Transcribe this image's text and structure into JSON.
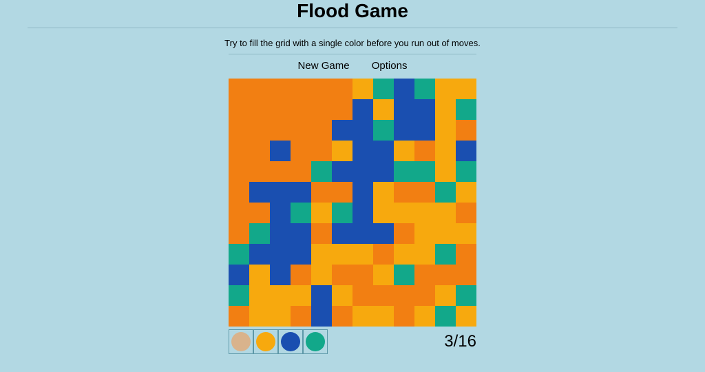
{
  "header": {
    "title": "Flood Game",
    "instructions": "Try to fill the grid with a single color before you run out of moves."
  },
  "menu": {
    "new_game": "New Game",
    "options": "Options"
  },
  "palette": {
    "colors": {
      "0": "#f27f12",
      "1": "#f7a90e",
      "2": "#1a4fb0",
      "3": "#12a88a",
      "4": "#d9b38c"
    }
  },
  "swatches": [
    {
      "name": "tan",
      "color": "#d9b38c"
    },
    {
      "name": "gold",
      "color": "#f7a90e"
    },
    {
      "name": "blue",
      "color": "#1a4fb0"
    },
    {
      "name": "teal",
      "color": "#12a88a"
    }
  ],
  "moves": {
    "current": 3,
    "total": 16,
    "display": "3/16"
  },
  "grid": [
    [
      0,
      0,
      0,
      0,
      0,
      0,
      1,
      3,
      2,
      3,
      1,
      1
    ],
    [
      0,
      0,
      0,
      0,
      0,
      0,
      2,
      1,
      2,
      2,
      1,
      3
    ],
    [
      0,
      0,
      0,
      0,
      0,
      2,
      2,
      3,
      2,
      2,
      1,
      0
    ],
    [
      0,
      0,
      2,
      0,
      0,
      1,
      2,
      2,
      1,
      0,
      1,
      2
    ],
    [
      0,
      0,
      0,
      0,
      3,
      2,
      2,
      2,
      3,
      3,
      1,
      3
    ],
    [
      0,
      2,
      2,
      2,
      0,
      0,
      2,
      1,
      0,
      0,
      3,
      1
    ],
    [
      0,
      0,
      2,
      3,
      1,
      3,
      2,
      1,
      1,
      1,
      1,
      0
    ],
    [
      0,
      3,
      2,
      2,
      0,
      2,
      2,
      2,
      0,
      1,
      1,
      1
    ],
    [
      3,
      2,
      2,
      2,
      1,
      1,
      1,
      0,
      1,
      1,
      3,
      0
    ],
    [
      2,
      1,
      2,
      0,
      1,
      0,
      0,
      1,
      3,
      0,
      0,
      0
    ],
    [
      3,
      1,
      1,
      1,
      2,
      1,
      0,
      0,
      0,
      0,
      1,
      3
    ],
    [
      0,
      1,
      1,
      0,
      2,
      0,
      1,
      1,
      0,
      1,
      3,
      1
    ]
  ]
}
